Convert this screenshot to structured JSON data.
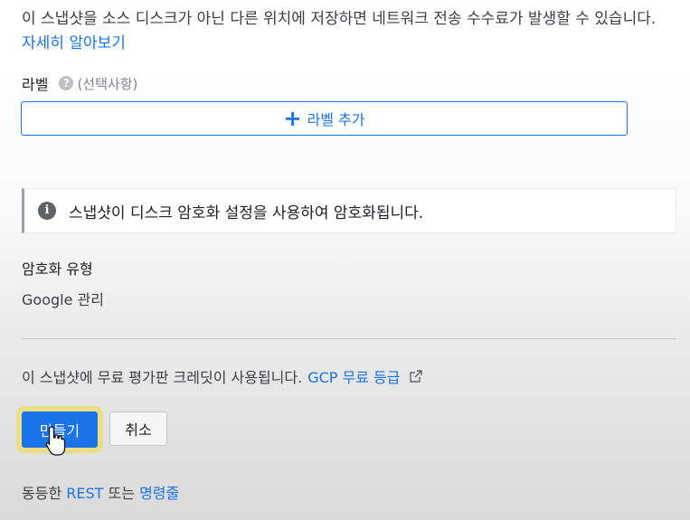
{
  "notice": {
    "text": "이 스냅샷을 소스 디스크가 아닌 다른 위치에 저장하면 네트워크 전송 수수료가 발생할 수 있습니다.",
    "link": "자세히 알아보기"
  },
  "labels": {
    "title": "라벨",
    "optional": "(선택사항)",
    "add_button": "라벨 추가"
  },
  "info": {
    "message": "스냅샷이 디스크 암호화 설정을 사용하여 암호화됩니다."
  },
  "encryption": {
    "title": "암호화 유형",
    "value": "Google 관리"
  },
  "credit": {
    "text": "이 스냅샷에 무료 평가판 크레딧이 사용됩니다.",
    "link": "GCP 무료 등급"
  },
  "actions": {
    "create": "만들기",
    "cancel": "취소"
  },
  "rest": {
    "prefix": "동등한",
    "rest_link": "REST",
    "middle": "또는",
    "cmd_link": "명령줄"
  },
  "colors": {
    "accent": "#1a73e8"
  }
}
